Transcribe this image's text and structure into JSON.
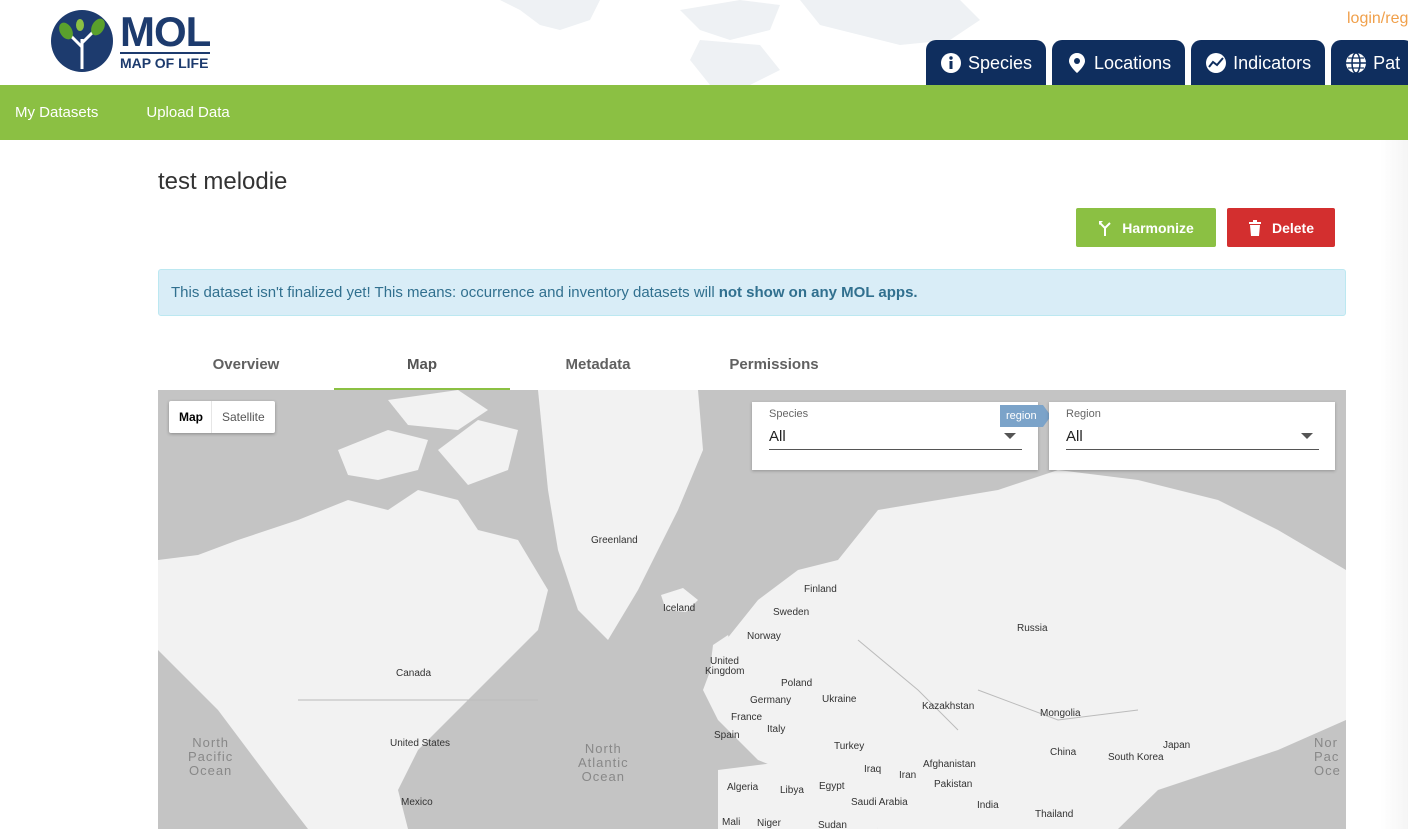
{
  "header": {
    "logo_title": "MOL",
    "logo_subtitle": "MAP OF LIFE",
    "login_label": "login/reg",
    "nav": [
      {
        "label": "Species",
        "icon": "info-icon"
      },
      {
        "label": "Locations",
        "icon": "location-pin-icon"
      },
      {
        "label": "Indicators",
        "icon": "chart-line-icon"
      },
      {
        "label": "Pat",
        "icon": "globe-icon"
      }
    ]
  },
  "subnav": {
    "items": [
      "My Datasets",
      "Upload Data"
    ]
  },
  "dataset": {
    "title": "test melodie",
    "harmonize_label": "Harmonize",
    "delete_label": "Delete",
    "alert_text": "This dataset isn't finalized yet! This means: occurrence and inventory datasets will",
    "alert_bold": "not show on any MOL apps."
  },
  "tabs": [
    "Overview",
    "Map",
    "Metadata",
    "Permissions"
  ],
  "active_tab": "Map",
  "map": {
    "type_map": "Map",
    "type_satellite": "Satellite",
    "species_filter": {
      "label": "Species",
      "value": "All"
    },
    "region_tag": "region",
    "region_filter": {
      "label": "Region",
      "value": "All"
    },
    "labels": {
      "greenland": "Greenland",
      "iceland": "Iceland",
      "finland": "Finland",
      "sweden": "Sweden",
      "norway": "Norway",
      "united_kingdom_1": "United",
      "united_kingdom_2": "Kingdom",
      "russia": "Russia",
      "canada": "Canada",
      "poland": "Poland",
      "germany": "Germany",
      "ukraine": "Ukraine",
      "kazakhstan": "Kazakhstan",
      "mongolia": "Mongolia",
      "france": "France",
      "italy": "Italy",
      "spain": "Spain",
      "turkey": "Turkey",
      "united_states": "United States",
      "china": "China",
      "japan": "Japan",
      "south_korea": "South Korea",
      "afghanistan": "Afghanistan",
      "iraq": "Iraq",
      "iran": "Iran",
      "pakistan": "Pakistan",
      "algeria": "Algeria",
      "libya": "Libya",
      "egypt": "Egypt",
      "saudi_arabia": "Saudi Arabia",
      "india": "India",
      "mexico": "Mexico",
      "mali": "Mali",
      "niger": "Niger",
      "sudan": "Sudan",
      "thailand": "Thailand",
      "north_pacific_1": "North",
      "north_pacific_2": "Pacific",
      "north_pacific_3": "Ocean",
      "north_atlantic_1": "North",
      "north_atlantic_2": "Atlantic",
      "north_atlantic_3": "Ocean",
      "right_pacific_1": "Nor",
      "right_pacific_2": "Pac",
      "right_pacific_3": "Oce"
    }
  },
  "colors": {
    "brand_navy": "#0f2e5e",
    "brand_green": "#8bc043",
    "delete_red": "#d32f2f",
    "login_orange": "#f0a04b"
  }
}
